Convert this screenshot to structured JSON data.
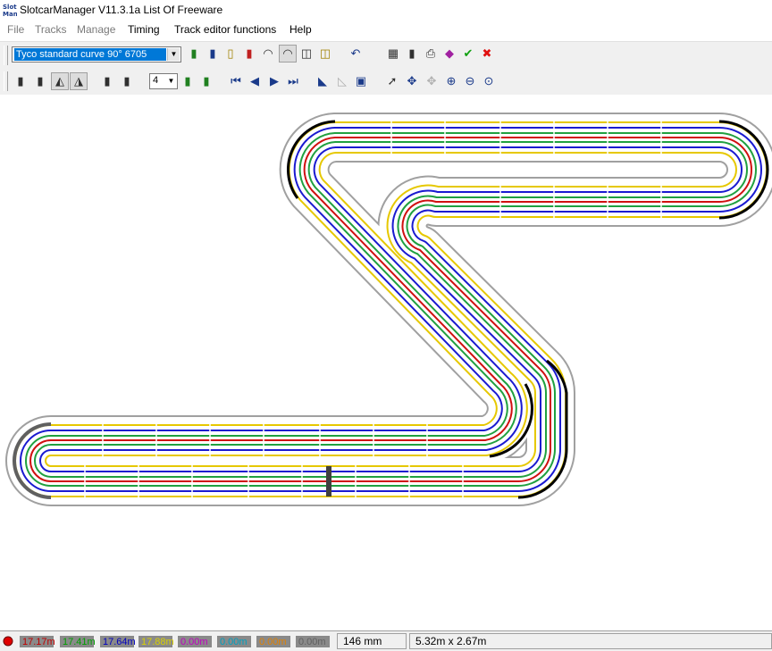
{
  "window": {
    "title": "SlotcarManager V11.3.1a List Of Freeware",
    "app_icon": "slotcar-manager-icon"
  },
  "menu": {
    "file": "File",
    "tracks": "Tracks",
    "manage": "Manage",
    "timing": "Timing",
    "track_editor": "Track editor functions",
    "help": "Help"
  },
  "toolbar1": {
    "track_piece": "Tyco standard curve 90° 6705"
  },
  "toolbar2": {
    "lanes_value": "4"
  },
  "status": {
    "record_indicator_color": "#e00000",
    "lanes": [
      {
        "value": "17.17m",
        "bg": "#8a8a8a",
        "fg": "#c00000"
      },
      {
        "value": "17.41m",
        "bg": "#8a8a8a",
        "fg": "#00a000"
      },
      {
        "value": "17.64m",
        "bg": "#8a8a8a",
        "fg": "#0000c0"
      },
      {
        "value": "17.88m",
        "bg": "#8a8a8a",
        "fg": "#d8d000"
      },
      {
        "value": "0.00m",
        "bg": "#8a8a8a",
        "fg": "#c000c0"
      },
      {
        "value": "0.00m",
        "bg": "#8a8a8a",
        "fg": "#00a0c0"
      },
      {
        "value": "0.00m",
        "bg": "#8a8a8a",
        "fg": "#e08000"
      },
      {
        "value": "0.00m",
        "bg": "#8a8a8a",
        "fg": "#606060"
      }
    ],
    "piece_size": "146 mm",
    "track_dimensions": "5.32m x 2.67m"
  }
}
